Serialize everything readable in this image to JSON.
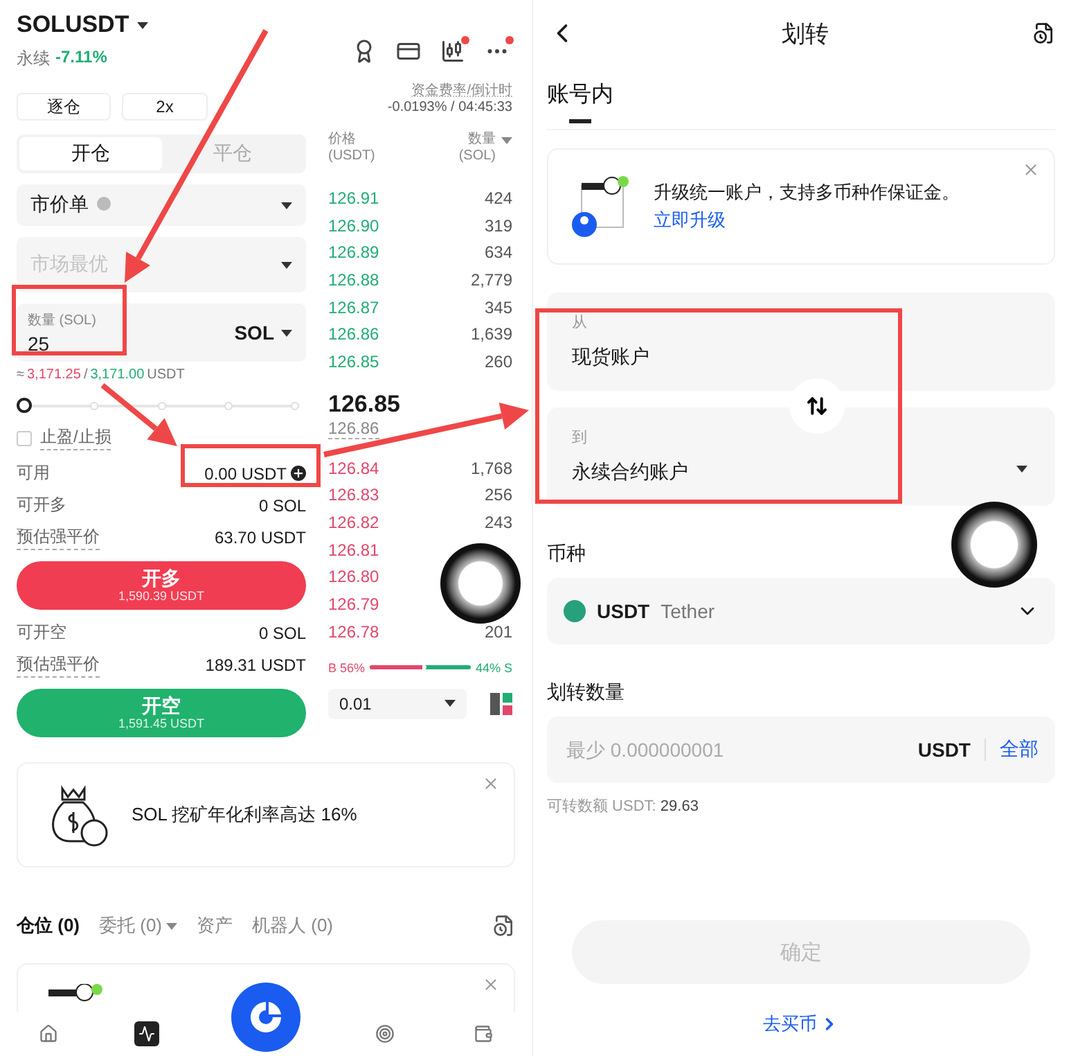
{
  "left": {
    "symbol": "SOLUSDT",
    "contract_type": "永续",
    "change": "-7.11%",
    "margin_mode": "逐仓",
    "leverage": "2x",
    "funding_label": "资金费率/倒计时",
    "funding_value": "-0.0193% / 04:45:33",
    "order_tabs": [
      {
        "label": "开仓",
        "selected": true
      },
      {
        "label": "平仓",
        "selected": false
      }
    ],
    "order_type": "市价单",
    "price_field": {
      "placeholder": "市场最优"
    },
    "quantity_field": {
      "label": "数量 (SOL)",
      "value": "25",
      "unit": "SOL"
    },
    "estimate": {
      "approx": "≈",
      "high": "3,171.25",
      "separator": "/",
      "low": "3,171.00",
      "unit": "USDT"
    },
    "slider": {
      "level": 0
    },
    "tpsl": {
      "label": "止盈/止损",
      "checked": false
    },
    "long_rows": [
      {
        "label": "可用",
        "value": "0.00 USDT",
        "dotted": false,
        "add": true
      },
      {
        "label": "可开多",
        "value": "0 SOL",
        "dotted": false,
        "add": false
      },
      {
        "label": "预估强平价",
        "value": "63.70 USDT",
        "dotted": true,
        "add": false
      }
    ],
    "long_button": {
      "label": "开多",
      "amount": "1,590.39 USDT"
    },
    "short_rows": [
      {
        "label": "可开空",
        "value": "0 SOL",
        "dotted": false,
        "add": false
      },
      {
        "label": "预估强平价",
        "value": "189.31 USDT",
        "dotted": true,
        "add": false
      }
    ],
    "short_button": {
      "label": "开空",
      "amount": "1,591.45 USDT"
    },
    "book_header": {
      "price_label": "价格",
      "price_unit": "(USDT)",
      "qty_label": "数量",
      "qty_unit": "(SOL)"
    },
    "upper_rows": [
      {
        "price": "126.91",
        "qty": "424"
      },
      {
        "price": "126.90",
        "qty": "319"
      },
      {
        "price": "126.89",
        "qty": "634"
      },
      {
        "price": "126.88",
        "qty": "2,779"
      },
      {
        "price": "126.87",
        "qty": "345"
      },
      {
        "price": "126.86",
        "qty": "1,639"
      },
      {
        "price": "126.85",
        "qty": "260"
      }
    ],
    "last_price": "126.85",
    "mark_price": "126.86",
    "lower_rows": [
      {
        "price": "126.84",
        "qty": "1,768"
      },
      {
        "price": "126.83",
        "qty": "256"
      },
      {
        "price": "126.82",
        "qty": "243"
      },
      {
        "price": "126.81"
      },
      {
        "price": "126.80"
      },
      {
        "price": "126.79"
      },
      {
        "price": "126.78",
        "qty": "201"
      }
    ],
    "ratio": {
      "buy": "B 56%",
      "sell": "44% S",
      "level": 0.56
    },
    "precision": "0.01",
    "promo": {
      "text": "SOL 挖矿年化利率高达 16%"
    },
    "position_tabs": [
      {
        "label": "仓位 (0)",
        "selected": true,
        "dropdown": false
      },
      {
        "label": "委托 (0)",
        "selected": false,
        "dropdown": true
      },
      {
        "label": "资产",
        "selected": false,
        "dropdown": false
      },
      {
        "label": "机器人 (0)",
        "selected": false,
        "dropdown": false
      }
    ],
    "bottom_nav": [
      {
        "kind": "home",
        "selected": false
      },
      {
        "kind": "market",
        "selected": true
      },
      {
        "kind": "trade",
        "selected": false
      },
      {
        "kind": "earn",
        "selected": false
      },
      {
        "kind": "wallet",
        "selected": false
      }
    ]
  },
  "right": {
    "title": "划转",
    "tabs": [
      {
        "label": "账号内",
        "selected": true
      }
    ],
    "banner": {
      "text": "升级统一账户，支持多币种作保证金。",
      "link": "立即升级"
    },
    "from_label": "从",
    "from_value": "现货账户",
    "to_label": "到",
    "to_value": "永续合约账户",
    "coin_label": "币种",
    "coin": "USDT",
    "coin_name": "Tether",
    "amount_label": "划转数量",
    "amount_placeholder": "最少 0.000000001",
    "amount_unit": "USDT",
    "all_link": "全部",
    "available_label": "可转数额 USDT:",
    "available_value": "29.63",
    "confirm": {
      "label": "确定",
      "disabled": true
    },
    "buy_link": "去买币"
  }
}
